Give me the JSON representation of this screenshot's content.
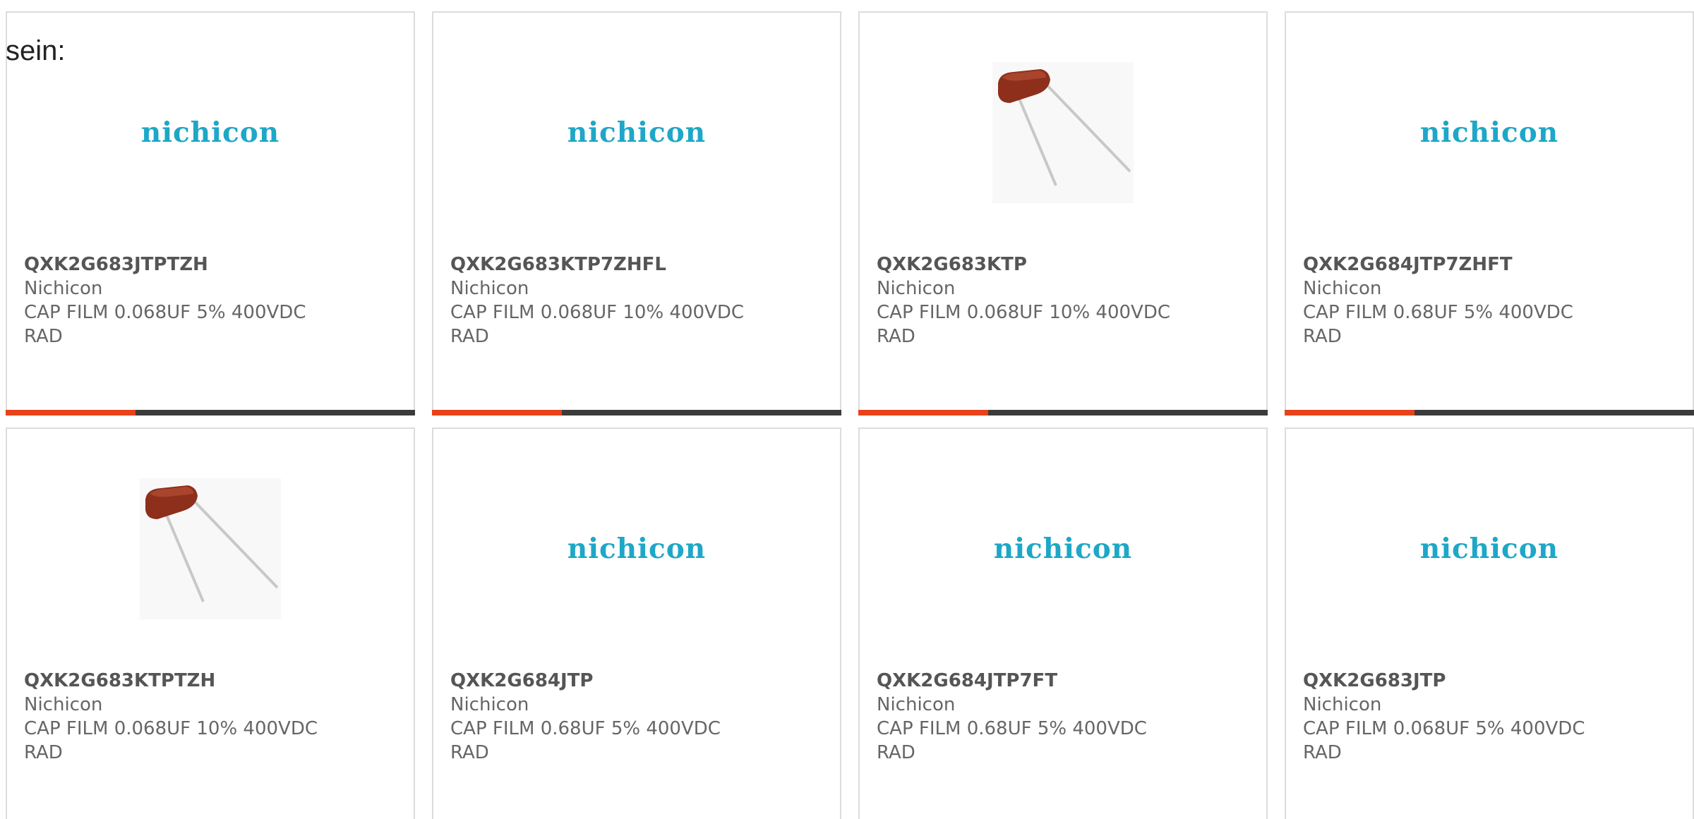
{
  "intro": "sein:",
  "cards": [
    {
      "part": "QXK2G683JTPTZH",
      "mfr": "Nichicon",
      "desc": "CAP FILM 0.068UF 5% 400VDC",
      "desc2": "RAD",
      "image": "logo",
      "logo_text": "nichicon",
      "has_bar": true
    },
    {
      "part": "QXK2G683KTP7ZHFL",
      "mfr": "Nichicon",
      "desc": "CAP FILM 0.068UF 10% 400VDC",
      "desc2": "RAD",
      "image": "logo",
      "logo_text": "nichicon",
      "has_bar": true
    },
    {
      "part": "QXK2G683KTP",
      "mfr": "Nichicon",
      "desc": "CAP FILM 0.068UF 10% 400VDC",
      "desc2": "RAD",
      "image": "capacitor-photo",
      "has_bar": true
    },
    {
      "part": "QXK2G684JTP7ZHFT",
      "mfr": "Nichicon",
      "desc": "CAP FILM 0.68UF 5% 400VDC",
      "desc2": "RAD",
      "image": "logo",
      "logo_text": "nichicon",
      "has_bar": true
    },
    {
      "part": "QXK2G683KTPTZH",
      "mfr": "Nichicon",
      "desc": "CAP FILM 0.068UF 10% 400VDC",
      "desc2": "RAD",
      "image": "capacitor-photo",
      "has_bar": false
    },
    {
      "part": "QXK2G684JTP",
      "mfr": "Nichicon",
      "desc": "CAP FILM 0.68UF 5% 400VDC",
      "desc2": "RAD",
      "image": "logo",
      "logo_text": "nichicon",
      "has_bar": false
    },
    {
      "part": "QXK2G684JTP7FT",
      "mfr": "Nichicon",
      "desc": "CAP FILM 0.68UF 5% 400VDC",
      "desc2": "RAD",
      "image": "logo",
      "logo_text": "nichicon",
      "has_bar": false
    },
    {
      "part": "QXK2G683JTP",
      "mfr": "Nichicon",
      "desc": "CAP FILM 0.068UF 5% 400VDC",
      "desc2": "RAD",
      "image": "logo",
      "logo_text": "nichicon",
      "has_bar": false
    }
  ],
  "colors": {
    "brand_logo": "#1ea7c7",
    "bar_accent": "#e8421a",
    "bar_dark": "#3b3b3b",
    "card_border": "#dcdcdc",
    "text": "#666666"
  }
}
